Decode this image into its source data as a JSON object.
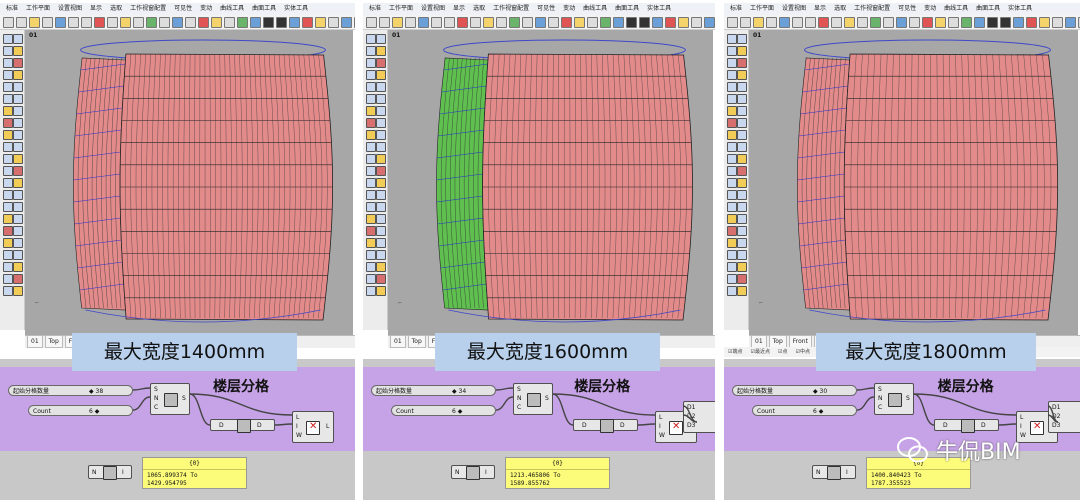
{
  "menu_items": [
    "标准",
    "工作平面",
    "设置视图",
    "显示",
    "选取",
    "工作视窗配置",
    "可见性",
    "变动",
    "曲线工具",
    "曲面工具",
    "实体工具"
  ],
  "viewport_label": "01",
  "view_tabs": [
    "01",
    "Top",
    "Front",
    "Right"
  ],
  "status_items": [
    "端点",
    "最近点",
    "点",
    "中点"
  ],
  "component_title": "楼层分格",
  "colors": {
    "facade_salmon": "#e38b8b",
    "facade_green": "#5fbf4f",
    "viewport_gray": "#a7a7a7",
    "canvas_purple": "#c6a3e6",
    "panel_yellow": "#fdfc7a",
    "label_blue": "#b8d0ec"
  },
  "panels": [
    {
      "width_label": "最大宽度1400mm",
      "slider_start_label": "起始分格数量",
      "slider_start_value": "◆ 38",
      "slider_count_label": "Count",
      "slider_count_value": "6 ◆",
      "panel_index": "{0}",
      "panel_line1": "1065.899374 To",
      "panel_line2": "1429.954795",
      "green_highlight": false
    },
    {
      "width_label": "最大宽度1600mm",
      "slider_start_label": "起始分格数量",
      "slider_start_value": "◆ 34",
      "slider_count_label": "Count",
      "slider_count_value": "6 ◆",
      "panel_index": "{0}",
      "panel_line1": "1213.465806 To",
      "panel_line2": "1589.855762",
      "green_highlight": true
    },
    {
      "width_label": "最大宽度1800mm",
      "slider_start_label": "起始分格数量",
      "slider_start_value": "◆ 30",
      "slider_count_label": "Count",
      "slider_count_value": "6 ◆",
      "panel_index": "{0}",
      "panel_line1": "1400.840423 To",
      "panel_line2": "1787.355523",
      "green_highlight": false
    }
  ],
  "ports": {
    "series_in": [
      "S",
      "N",
      "C"
    ],
    "series_out": "S",
    "dispatch_in": [
      "L",
      "I",
      "W"
    ],
    "dispatch_out": "L",
    "domain_out": [
      "D1",
      "D2",
      "D3"
    ],
    "range_in": "N",
    "range_out": "I",
    "panel_in": "D",
    "panel_out": "D"
  },
  "watermark": "牛侃BIM"
}
